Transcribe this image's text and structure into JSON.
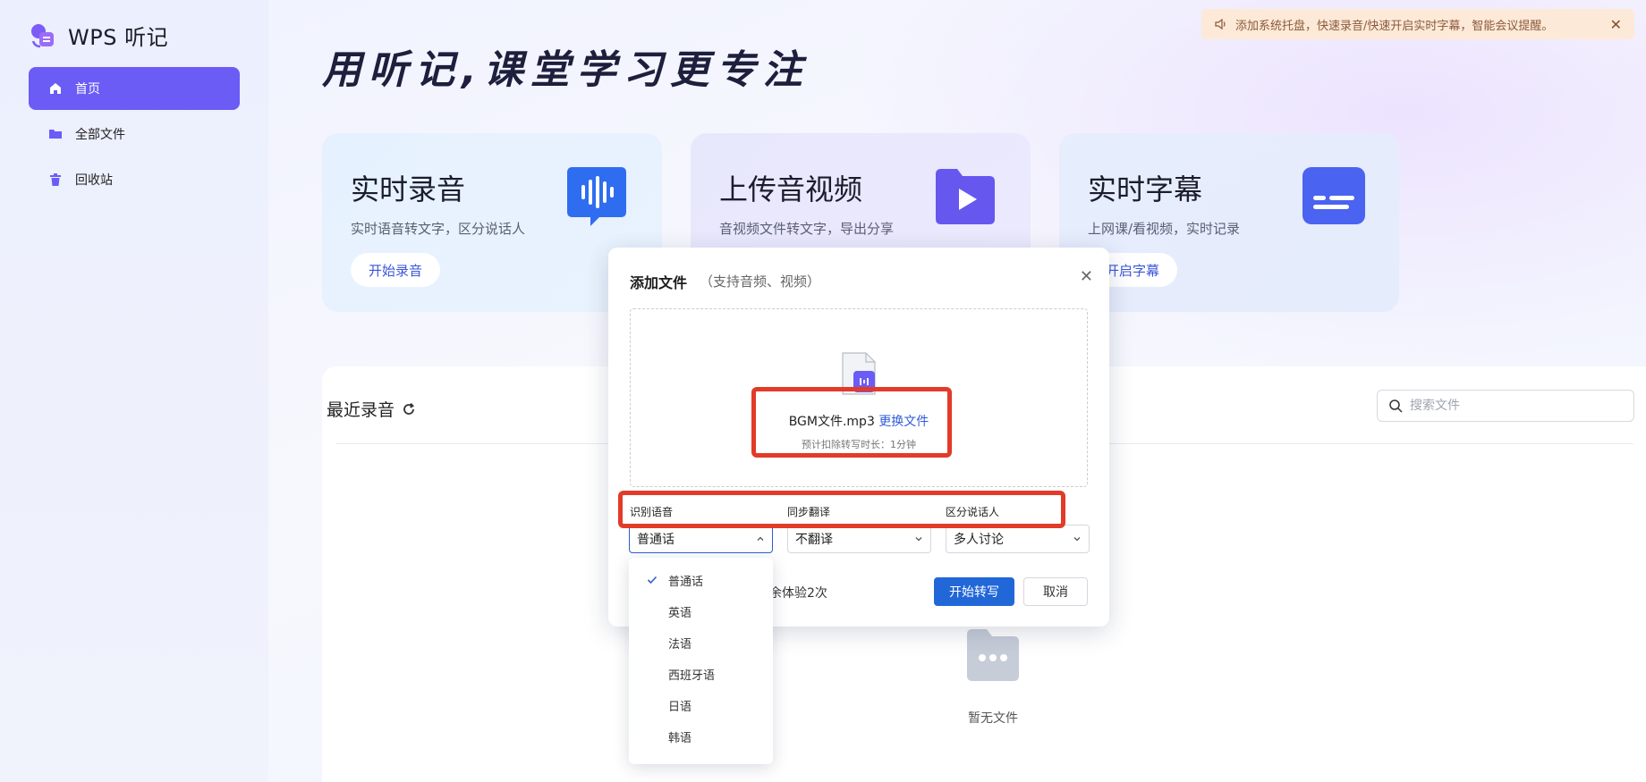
{
  "app": {
    "name": "WPS 听记"
  },
  "sidebar": {
    "items": [
      {
        "label": "首页",
        "icon": "home-icon",
        "active": true
      },
      {
        "label": "全部文件",
        "icon": "folder-icon",
        "active": false
      },
      {
        "label": "回收站",
        "icon": "trash-icon",
        "active": false
      }
    ]
  },
  "hero": {
    "headline": "用听记,课堂学习更专注"
  },
  "notice": {
    "text": "添加系统托盘，快速录音/快速开启实时字幕，智能会议提醒。"
  },
  "cards": [
    {
      "title": "实时录音",
      "subtitle": "实时语音转文字，区分说话人",
      "button": "开始录音",
      "icon": "voice-wave-icon"
    },
    {
      "title": "上传音视频",
      "subtitle": "音视频文件转文字，导出分享",
      "button": "",
      "icon": "video-folder-icon"
    },
    {
      "title": "实时字幕",
      "subtitle": "上网课/看视频，实时记录",
      "button": "开启字幕",
      "icon": "subtitle-icon"
    }
  ],
  "recent": {
    "title": "最近录音",
    "search_placeholder": "搜索文件",
    "empty_text": "暂无文件"
  },
  "dialog": {
    "title": "添加文件",
    "subtitle": "（支持音频、视频）",
    "file_name": "BGM文件.mp3",
    "change_file": "更换文件",
    "hint": "预计扣除转写时长：1分钟",
    "fields": {
      "language_label": "识别语音",
      "language_value": "普通话",
      "translate_label": "同步翻译",
      "translate_value": "不翻译",
      "speaker_label": "区分说话人",
      "speaker_value": "多人讨论"
    },
    "quota_text": "余体验2次",
    "start_button": "开始转写",
    "cancel_button": "取消"
  },
  "language_dropdown": {
    "selected": "普通话",
    "options": [
      "普通话",
      "英语",
      "法语",
      "西班牙语",
      "日语",
      "韩语"
    ]
  },
  "colors": {
    "accent": "#6b5cf6",
    "primary_button": "#2167d8",
    "highlight": "#e23b29",
    "link": "#2f5cd8"
  }
}
